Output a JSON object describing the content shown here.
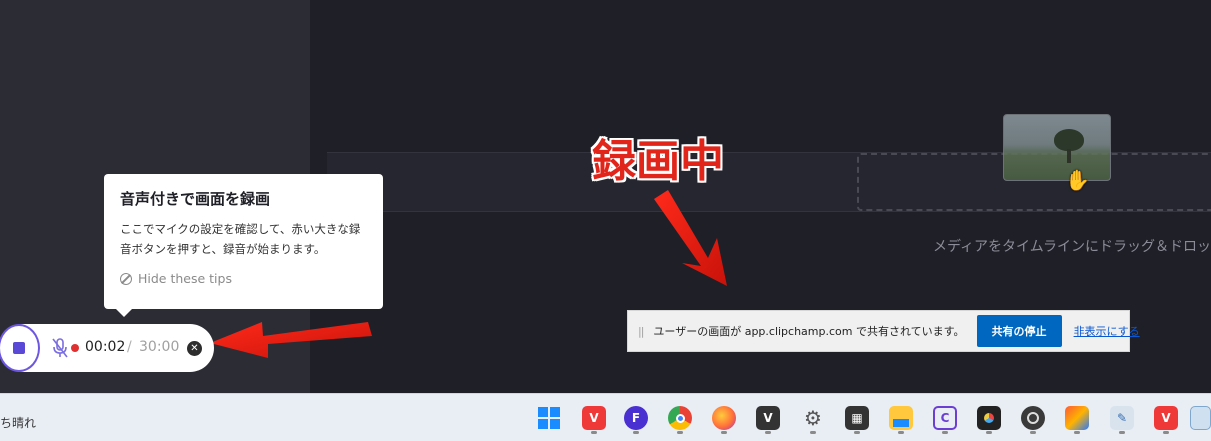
{
  "annotation": {
    "recording_label": "録画中"
  },
  "tip": {
    "title": "音声付きで画面を録画",
    "body": "ここでマイクの設定を確認して、赤い大きな録音ボタンを押すと、録音が始まります。",
    "hide_label": "Hide these tips"
  },
  "recorder": {
    "elapsed": "00:02",
    "separator": "/",
    "max": "30:00"
  },
  "editor": {
    "drop_hint": "メディアをタイムラインにドラッグ＆ドロップ"
  },
  "share_bar": {
    "message": "ユーザーの画面が app.clipchamp.com で共有されています。",
    "stop_label": "共有の停止",
    "hide_label": "非表示にする"
  },
  "taskbar": {
    "weather_text": "ち晴れ",
    "icons": [
      "windows-start-icon",
      "vivaldi-icon",
      "clipchamp-f-icon",
      "chrome-icon",
      "firefox-icon",
      "vivaldi-alt-icon",
      "settings-gear-icon",
      "media-app-icon",
      "file-explorer-icon",
      "clipchamp-c-icon",
      "davinci-resolve-icon",
      "obs-icon",
      "vivaldi-snapshot-icon",
      "notepad-icon",
      "vivaldi-2-icon",
      "clipchamp-window-icon"
    ]
  },
  "colors": {
    "accent_red": "#e1251b",
    "share_blue": "#0067c0",
    "stop_purple": "#5a48d6"
  }
}
